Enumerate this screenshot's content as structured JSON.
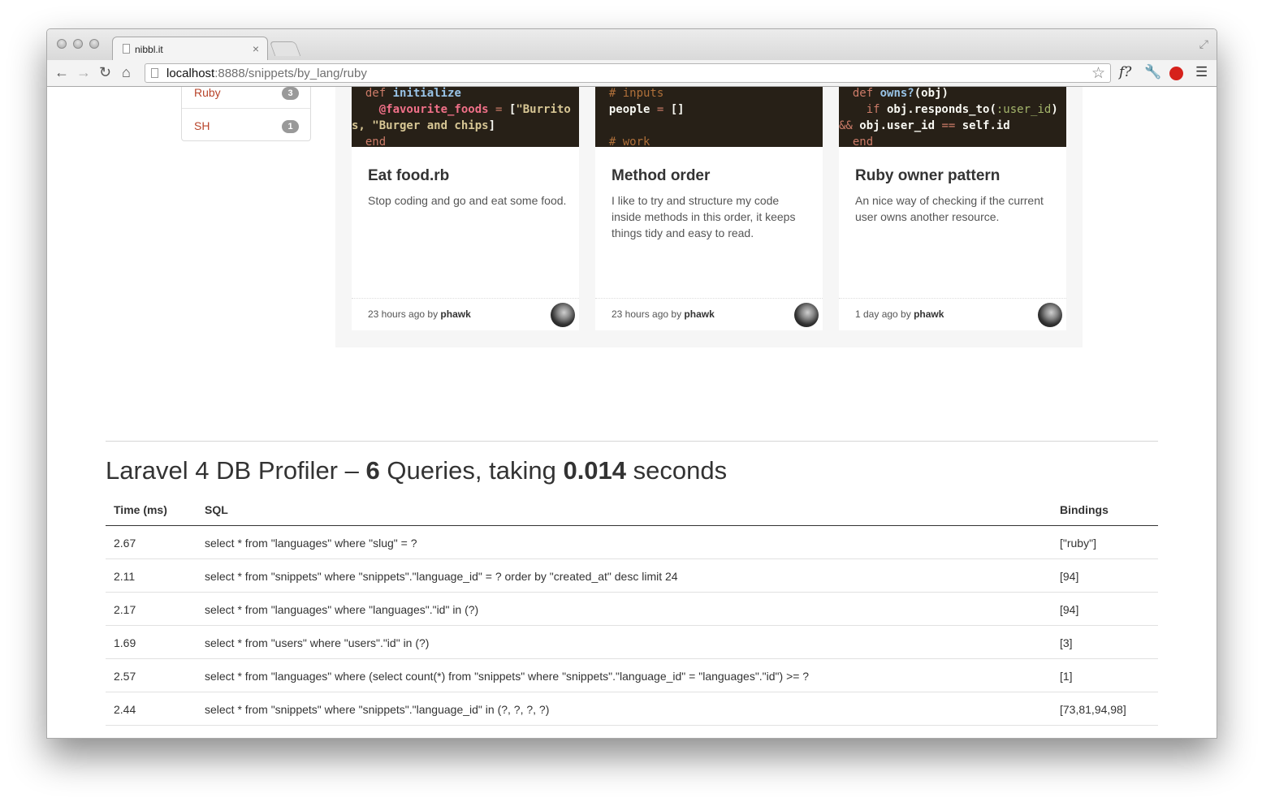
{
  "browser": {
    "tab_title": "nibbl.it",
    "tab_close": "×",
    "url_host": "localhost",
    "url_rest": ":8888/snippets/by_lang/ruby",
    "ext_f": "f?"
  },
  "sidebar": {
    "items": [
      {
        "label": "Ruby",
        "count": "3"
      },
      {
        "label": "SH",
        "count": "1"
      }
    ]
  },
  "cards": [
    {
      "title": "Eat food.rb",
      "description": "Stop coding and go and eat some food.",
      "time": "23 hours ago by",
      "author": "phawk"
    },
    {
      "title": "Method order",
      "description": "I like to try and structure my code inside methods in this order, it keeps things tidy and easy to read.",
      "time": "23 hours ago by",
      "author": "phawk"
    },
    {
      "title": "Ruby owner pattern",
      "description": "An nice way of checking if the current user owns another resource.",
      "time": "1 day ago by",
      "author": "phawk"
    }
  ],
  "profiler": {
    "title_prefix": "Laravel 4 DB Profiler – ",
    "query_count": "6",
    "title_middle": " Queries, taking ",
    "total_time": "0.014",
    "title_suffix": " seconds",
    "headers": {
      "time": "Time (ms)",
      "sql": "SQL",
      "bindings": "Bindings"
    },
    "rows": [
      {
        "time": "2.67",
        "sql": "select * from \"languages\" where \"slug\" = ?",
        "bindings": "[\"ruby\"]"
      },
      {
        "time": "2.11",
        "sql": "select * from \"snippets\" where \"snippets\".\"language_id\" = ? order by \"created_at\" desc limit 24",
        "bindings": "[94]"
      },
      {
        "time": "2.17",
        "sql": "select * from \"languages\" where \"languages\".\"id\" in (?)",
        "bindings": "[94]"
      },
      {
        "time": "1.69",
        "sql": "select * from \"users\" where \"users\".\"id\" in (?)",
        "bindings": "[3]"
      },
      {
        "time": "2.57",
        "sql": "select * from \"languages\" where (select count(*) from \"snippets\" where \"snippets\".\"language_id\" = \"languages\".\"id\") >= ?",
        "bindings": "[1]"
      },
      {
        "time": "2.44",
        "sql": "select * from \"snippets\" where \"snippets\".\"language_id\" in (?, ?, ?, ?)",
        "bindings": "[73,81,94,98]"
      }
    ]
  }
}
